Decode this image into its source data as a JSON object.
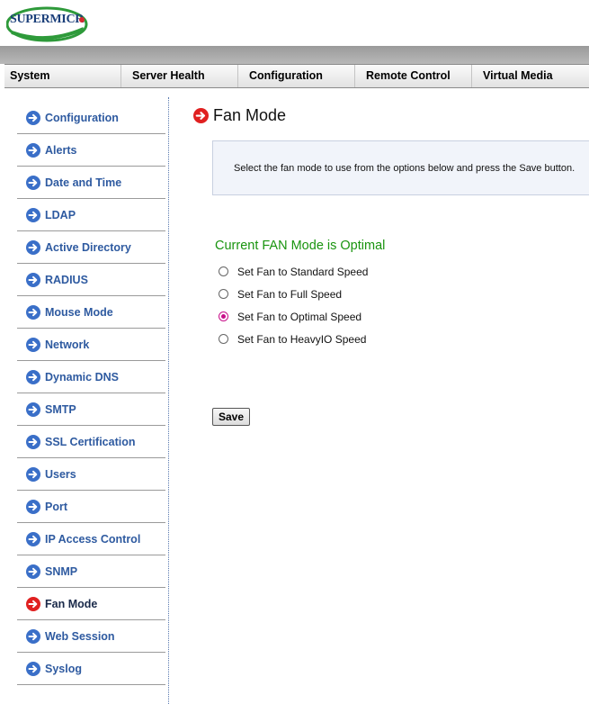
{
  "brand": {
    "logo_text": "SUPERMICR",
    "logo_color": "#1b3f7a",
    "swoosh_color": "#2e9a3a",
    "dot_color": "#d8282f"
  },
  "topnav": {
    "items": [
      {
        "label": "System"
      },
      {
        "label": "Server Health"
      },
      {
        "label": "Configuration"
      },
      {
        "label": "Remote Control"
      },
      {
        "label": "Virtual Media"
      }
    ]
  },
  "sidebar": {
    "icon": "arrow-right-circle-icon",
    "icon_color": "#3a6fc8",
    "active_icon_color": "#e02020",
    "items": [
      {
        "label": "Configuration"
      },
      {
        "label": "Alerts"
      },
      {
        "label": "Date and Time"
      },
      {
        "label": "LDAP"
      },
      {
        "label": "Active Directory"
      },
      {
        "label": "RADIUS"
      },
      {
        "label": "Mouse Mode"
      },
      {
        "label": "Network"
      },
      {
        "label": "Dynamic DNS"
      },
      {
        "label": "SMTP"
      },
      {
        "label": "SSL Certification"
      },
      {
        "label": "Users"
      },
      {
        "label": "Port"
      },
      {
        "label": "IP Access Control"
      },
      {
        "label": "SNMP"
      },
      {
        "label": "Fan Mode",
        "active": true
      },
      {
        "label": "Web Session"
      },
      {
        "label": "Syslog"
      }
    ]
  },
  "main": {
    "title": "Fan Mode",
    "instructions": "Select the fan mode to use from the options below and press the Save button.",
    "current_mode_text": "Current FAN Mode is Optimal",
    "current_mode_color": "#19940f",
    "options": [
      {
        "label": "Set Fan to Standard Speed",
        "checked": false
      },
      {
        "label": "Set Fan to Full Speed",
        "checked": false
      },
      {
        "label": "Set Fan to Optimal Speed",
        "checked": true
      },
      {
        "label": "Set Fan to HeavyIO Speed",
        "checked": false
      }
    ],
    "save_label": "Save"
  }
}
